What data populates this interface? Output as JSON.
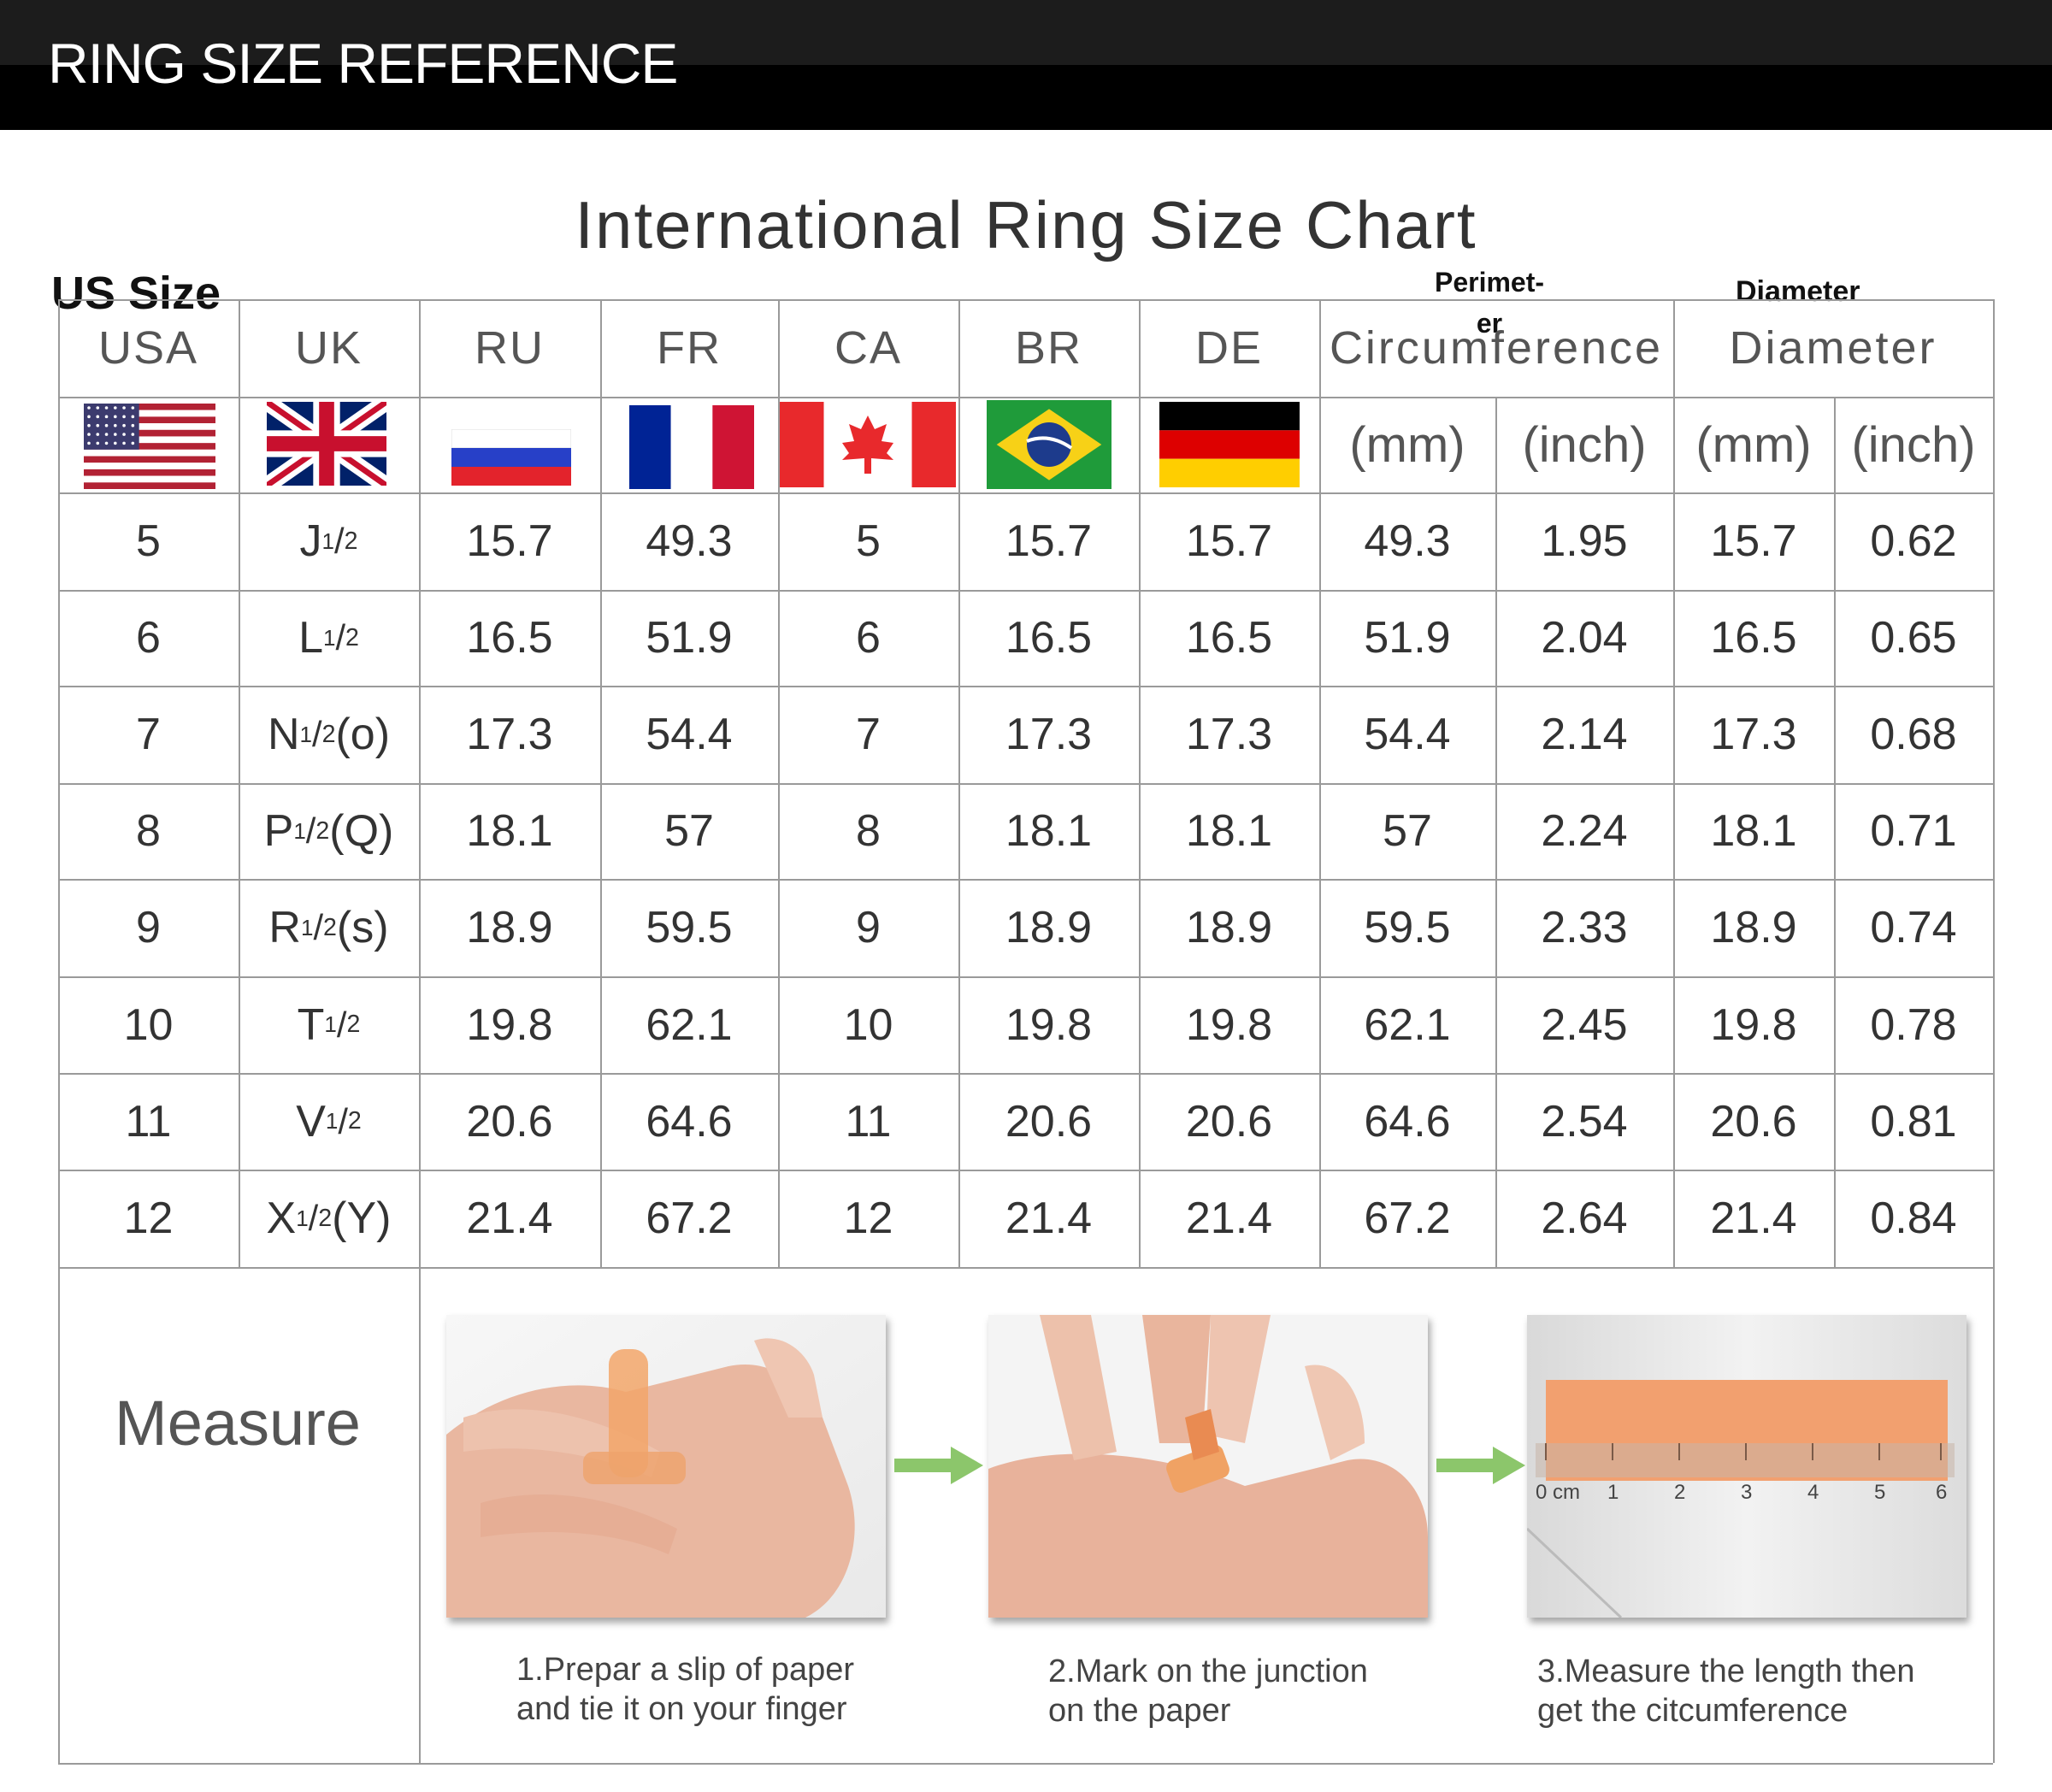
{
  "banner": {
    "title": "RING SIZE REFERENCE"
  },
  "chart": {
    "title": "International Ring Size Chart",
    "us_size_label": "US Size",
    "perimeter_label_line1": "Perimet-",
    "perimeter_label_line2": "er",
    "diameter_label": "Diameter",
    "headers": {
      "usa": "USA",
      "uk": "UK",
      "ru": "RU",
      "fr": "FR",
      "ca": "CA",
      "br": "BR",
      "de": "DE",
      "circumference": "Circumference",
      "diameter": "Diameter"
    },
    "units": {
      "circ_mm": "(mm)",
      "circ_inch": "(inch)",
      "diam_mm": "(mm)",
      "diam_inch": "(inch)"
    },
    "flags": [
      "us-flag-icon",
      "uk-flag-icon",
      "russia-flag-icon",
      "france-flag-icon",
      "canada-flag-icon",
      "brazil-flag-icon",
      "germany-flag-icon"
    ],
    "rows": [
      {
        "usa": "5",
        "uk_letter": "J",
        "uk_suffix": "",
        "ru": "15.7",
        "fr": "49.3",
        "ca": "5",
        "br": "15.7",
        "de": "15.7",
        "circ_mm": "49.3",
        "circ_inch": "1.95",
        "diam_mm": "15.7",
        "diam_inch": "0.62"
      },
      {
        "usa": "6",
        "uk_letter": "L",
        "uk_suffix": "",
        "ru": "16.5",
        "fr": "51.9",
        "ca": "6",
        "br": "16.5",
        "de": "16.5",
        "circ_mm": "51.9",
        "circ_inch": "2.04",
        "diam_mm": "16.5",
        "diam_inch": "0.65"
      },
      {
        "usa": "7",
        "uk_letter": "N",
        "uk_suffix": "(o)",
        "ru": "17.3",
        "fr": "54.4",
        "ca": "7",
        "br": "17.3",
        "de": "17.3",
        "circ_mm": "54.4",
        "circ_inch": "2.14",
        "diam_mm": "17.3",
        "diam_inch": "0.68"
      },
      {
        "usa": "8",
        "uk_letter": "P",
        "uk_suffix": "(Q)",
        "ru": "18.1",
        "fr": "57",
        "ca": "8",
        "br": "18.1",
        "de": "18.1",
        "circ_mm": "57",
        "circ_inch": "2.24",
        "diam_mm": "18.1",
        "diam_inch": "0.71"
      },
      {
        "usa": "9",
        "uk_letter": "R",
        "uk_suffix": "(s)",
        "ru": "18.9",
        "fr": "59.5",
        "ca": "9",
        "br": "18.9",
        "de": "18.9",
        "circ_mm": "59.5",
        "circ_inch": "2.33",
        "diam_mm": "18.9",
        "diam_inch": "0.74"
      },
      {
        "usa": "10",
        "uk_letter": "T",
        "uk_suffix": "",
        "ru": "19.8",
        "fr": "62.1",
        "ca": "10",
        "br": "19.8",
        "de": "19.8",
        "circ_mm": "62.1",
        "circ_inch": "2.45",
        "diam_mm": "19.8",
        "diam_inch": "0.78"
      },
      {
        "usa": "11",
        "uk_letter": "V",
        "uk_suffix": "",
        "ru": "20.6",
        "fr": "64.6",
        "ca": "11",
        "br": "20.6",
        "de": "20.6",
        "circ_mm": "64.6",
        "circ_inch": "2.54",
        "diam_mm": "20.6",
        "diam_inch": "0.81"
      },
      {
        "usa": "12",
        "uk_letter": "X",
        "uk_suffix": "(Y)",
        "ru": "21.4",
        "fr": "67.2",
        "ca": "12",
        "br": "21.4",
        "de": "21.4",
        "circ_mm": "67.2",
        "circ_inch": "2.64",
        "diam_mm": "21.4",
        "diam_inch": "0.84"
      }
    ]
  },
  "measure": {
    "label": "Measure",
    "steps": [
      {
        "line1": "1.Prepar a slip of paper",
        "line2": "and tie it on your finger",
        "image": "hand-with-paper-strip"
      },
      {
        "line1": "2.Mark on the junction",
        "line2": "on the paper",
        "image": "marking-paper-on-finger"
      },
      {
        "line1": "3.Measure the length then",
        "line2": "get the citcumference",
        "image": "ruler-measuring-paper"
      }
    ],
    "ruler_ticks": [
      "0 cm",
      "1",
      "2",
      "3",
      "4",
      "5",
      "6"
    ],
    "arrow_color": "#8cc66b"
  }
}
